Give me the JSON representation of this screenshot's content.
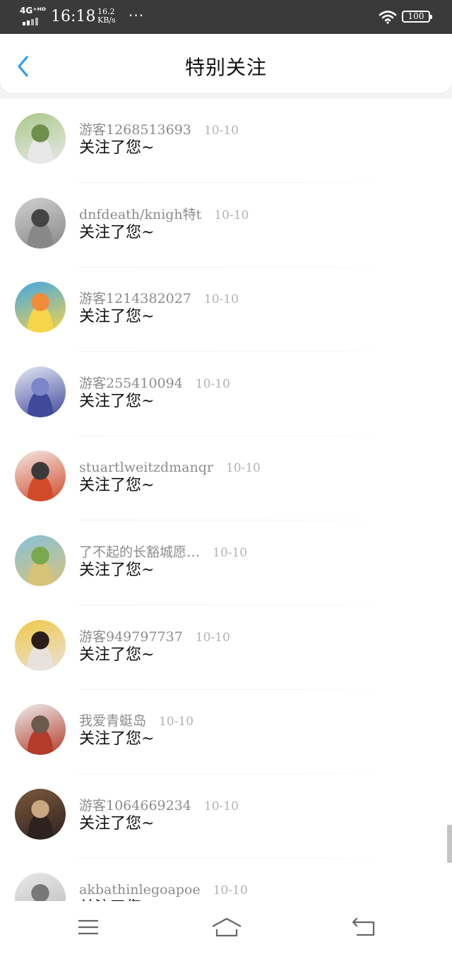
{
  "status_bar": {
    "network": "4G⁺ᴴᴰ",
    "time": "16:18",
    "speed_value": "16.2",
    "speed_unit": "KB/s",
    "more": "···",
    "battery": "100"
  },
  "header": {
    "title": "特别关注",
    "back_icon": "chevron-left-icon",
    "accent_color": "#2a9df4"
  },
  "followers": [
    {
      "name": "游客1268513693",
      "date": "10-10",
      "message": "关注了您~",
      "avatar_colors": [
        "#a9c98a",
        "#6e8f4d",
        "#e8e8e8"
      ]
    },
    {
      "name": "dnfdeath/knigh特t",
      "date": "10-10",
      "message": "关注了您~",
      "avatar_colors": [
        "#d0d0d0",
        "#444444",
        "#888888"
      ]
    },
    {
      "name": "游客1214382027",
      "date": "10-10",
      "message": "关注了您~",
      "avatar_colors": [
        "#41a6e6",
        "#f28b3a",
        "#f5d54a"
      ]
    },
    {
      "name": "游客255410094",
      "date": "10-10",
      "message": "关注了您~",
      "avatar_colors": [
        "#e6e8f6",
        "#7b86c9",
        "#3f4a9a"
      ]
    },
    {
      "name": "stuartlweitzdmanqr",
      "date": "10-10",
      "message": "关注了您~",
      "avatar_colors": [
        "#f3e7e3",
        "#3a3a3a",
        "#d14b2b"
      ]
    },
    {
      "name": "了不起的长豁城愿…",
      "date": "10-10",
      "message": "关注了您~",
      "avatar_colors": [
        "#87c1d9",
        "#7aa84c",
        "#d7c27a"
      ]
    },
    {
      "name": "游客949797737",
      "date": "10-10",
      "message": "关注了您~",
      "avatar_colors": [
        "#f0c946",
        "#2b1e1a",
        "#e9e2dc"
      ]
    },
    {
      "name": "我爱青蜓岛",
      "date": "10-10",
      "message": "关注了您~",
      "avatar_colors": [
        "#ededed",
        "#6b5a4c",
        "#b33b2a"
      ]
    },
    {
      "name": "游客1064669234",
      "date": "10-10",
      "message": "关注了您~",
      "avatar_colors": [
        "#7b5a3c",
        "#caa882",
        "#2e2220"
      ]
    },
    {
      "name": "akbathinlegoapoe",
      "date": "10-10",
      "message": "关注了您~",
      "avatar_colors": [
        "#e8e8e8",
        "#777777",
        "#bbbbbb"
      ]
    }
  ],
  "nav_bar": {
    "menu_icon": "menu-icon",
    "home_icon": "home-icon",
    "back_icon": "back-arrow-icon"
  }
}
